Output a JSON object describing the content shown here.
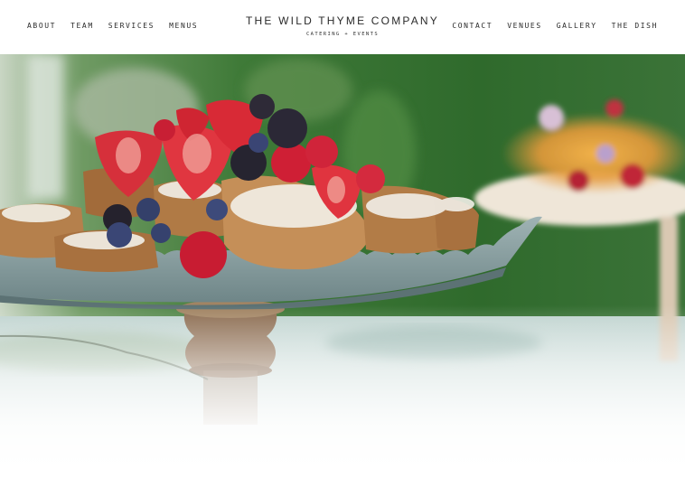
{
  "site": {
    "title": "THE WILD THYME COMPANY",
    "tagline": "CATERING + EVENTS"
  },
  "nav_left": [
    "ABOUT",
    "TEAM",
    "SERVICES",
    "MENUS"
  ],
  "nav_right": [
    "CONTACT",
    "VENUES",
    "GALLERY",
    "THE DISH"
  ],
  "hero": {
    "image": "dessert-cake-stand-photo",
    "colors": {
      "background_green": "#3e7a3a",
      "stand": "#8fa6a8",
      "berry_red": "#d62b3a"
    }
  }
}
